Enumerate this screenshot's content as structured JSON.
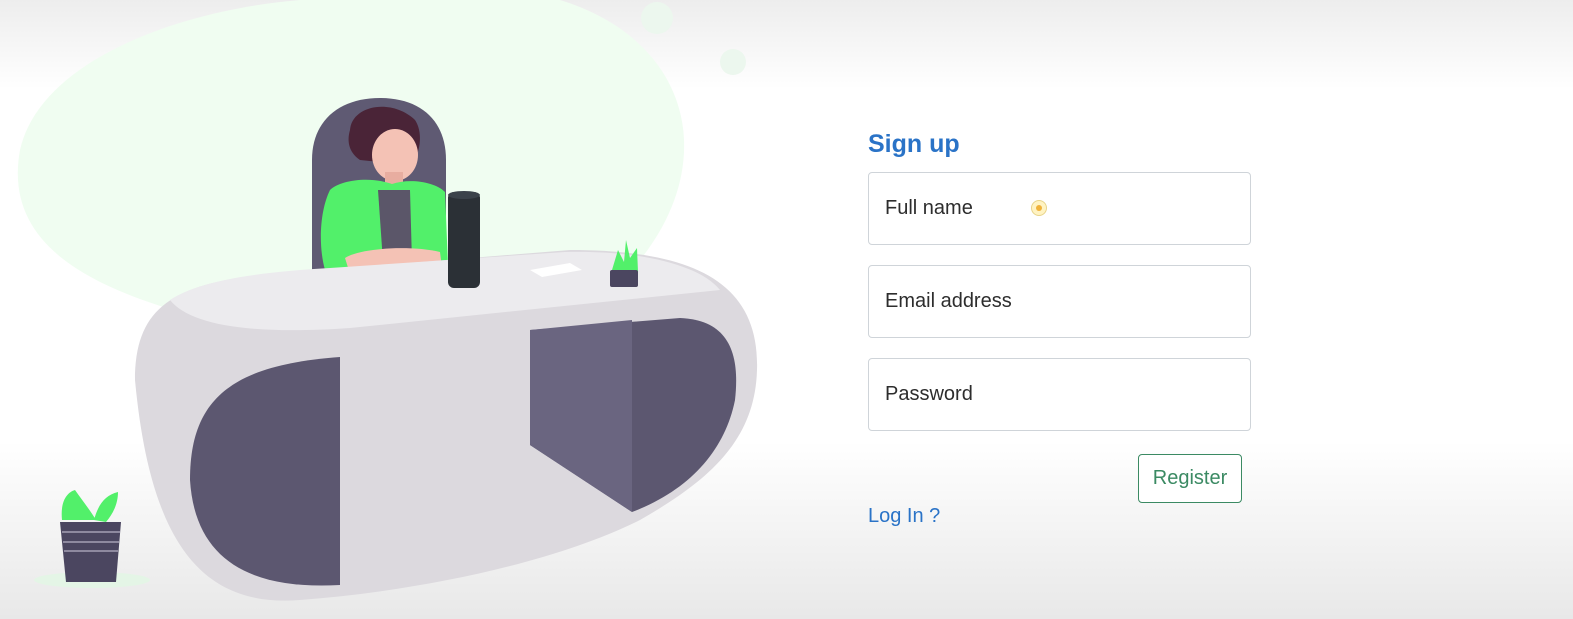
{
  "signup": {
    "title": "Sign up",
    "full_name_placeholder": "Full name",
    "email_placeholder": "Email address",
    "password_placeholder": "Password",
    "register_label": "Register",
    "login_link": "Log In ?"
  },
  "colors": {
    "title_blue": "#2a73c7",
    "register_green": "#3b8a63",
    "accent_green": "#52f06a",
    "desk_gray": "#d9d6dc",
    "desk_dark": "#5c5770"
  },
  "icons": [
    "cursor-indicator-icon",
    "office-illustration"
  ]
}
